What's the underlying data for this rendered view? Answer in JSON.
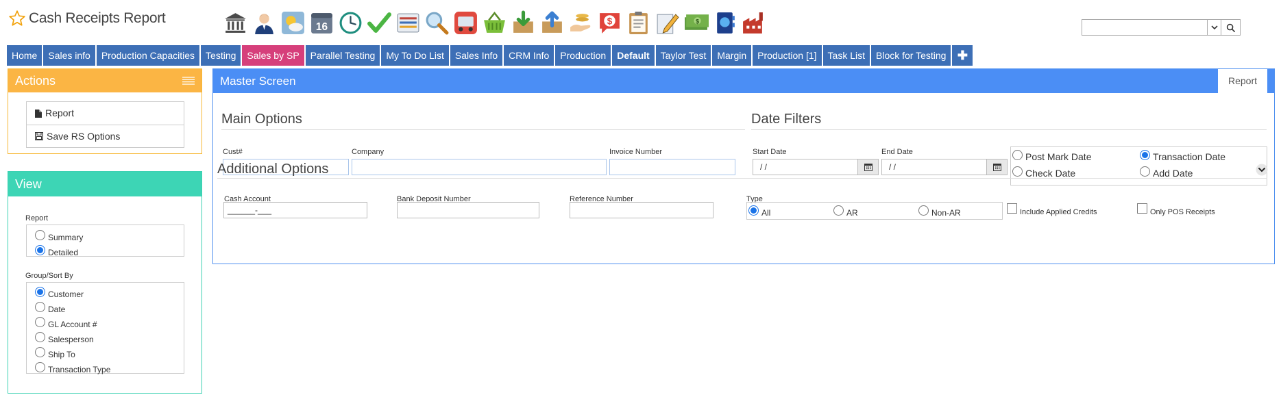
{
  "header": {
    "title": "Cash Receipts Report",
    "search_value": "",
    "toolbar_icons": [
      "bank-icon",
      "user-icon",
      "weather-icon",
      "calendar-16-icon",
      "clock-icon",
      "checkmark-icon",
      "list-icon",
      "magnifier-icon",
      "truck-icon",
      "basket-icon",
      "download-box-icon",
      "upload-box-icon",
      "hand-coins-icon",
      "dollar-chat-icon",
      "clipboard-icon",
      "pencil-icon",
      "money-icon",
      "contact-book-icon",
      "factory-icon"
    ],
    "calendar_day": "16"
  },
  "tabs": [
    "Home",
    "Sales info",
    "Production Capacities",
    "Testing",
    "Sales by SP",
    "Parallel Testing",
    "My To Do List",
    "Sales Info",
    "CRM Info",
    "Production",
    "Default",
    "Taylor Test",
    "Margin",
    "Production [1]",
    "Task List",
    "Block for Testing",
    "✚"
  ],
  "tabs_active": "Sales by SP",
  "actions": {
    "title": "Actions",
    "items": [
      "Report",
      "Save RS Options"
    ]
  },
  "view": {
    "title": "View",
    "report_label": "Report",
    "report_options": [
      "Summary",
      "Detailed"
    ],
    "report_selected": "Detailed",
    "group_label": "Group/Sort By",
    "group_options": [
      "Customer",
      "Date",
      "GL Account #",
      "Salesperson",
      "Ship To",
      "Transaction Type"
    ],
    "group_selected": "Customer"
  },
  "master": {
    "title": "Master Screen",
    "report_tab": "Report",
    "main_options": {
      "title": "Main Options",
      "cust_label": "Cust#",
      "company_label": "Company",
      "invoice_label": "Invoice Number",
      "cust_value": "",
      "company_value": "",
      "invoice_value": ""
    },
    "date_filters": {
      "title": "Date Filters",
      "start_label": "Start Date",
      "end_label": "End Date",
      "start_value": " /  /",
      "end_value": " /  /",
      "date_types": [
        "Post Mark Date",
        "Transaction Date",
        "Check Date",
        "Add Date"
      ],
      "date_type_selected": "Transaction Date"
    },
    "additional": {
      "title": "Additional Options",
      "cash_account_label": "Cash Account",
      "cash_account_value": "______-___",
      "bank_deposit_label": "Bank Deposit Number",
      "reference_label": "Reference Number",
      "type_label": "Type",
      "type_options": [
        "All",
        "AR",
        "Non-AR"
      ],
      "type_selected": "All",
      "include_applied_credits": "Include Applied Credits",
      "only_pos_receipts": "Only POS Receipts"
    }
  },
  "colors": {
    "tab_blue": "#3d6fb6",
    "tab_active_pink": "#d63f7b",
    "actions_orange": "#fbb544",
    "view_teal": "#3dd5b5",
    "master_blue": "#4b8ef5"
  }
}
